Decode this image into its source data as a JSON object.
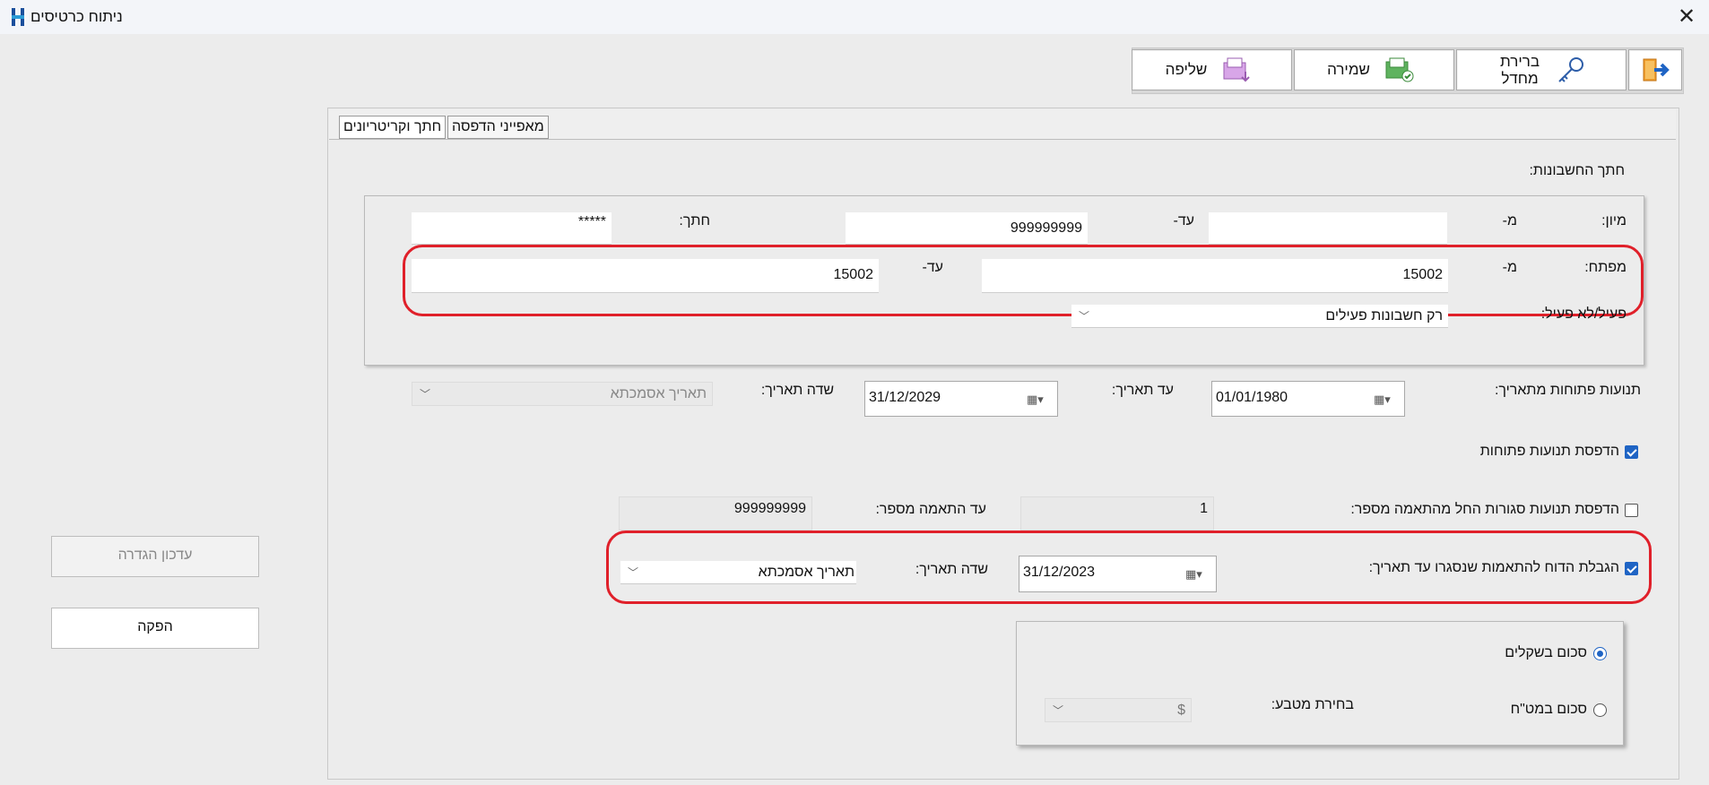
{
  "window": {
    "title": "ניתוח כרטיסים",
    "logo": "H"
  },
  "toolbar": {
    "exit_icon": "exit-door-arrow-icon",
    "password_label_line1": "ברירת",
    "password_label_line2": "מחדל",
    "save_label": "שמירה",
    "retrieve_label": "שליפה"
  },
  "tabs": {
    "criteria": "חתך וקריטריונים",
    "print": "מאפייני הדפסה"
  },
  "accounts_section": {
    "title": "חתך החשבונות:",
    "sort_label": "מיון:",
    "from_label": "מ-",
    "to_label": "עד-",
    "sort_from": "",
    "sort_to": "999999999",
    "cut_label": "חתך:",
    "cut_value": "*****",
    "key_label": "מפתח:",
    "key_from": "15002",
    "key_to": "15002",
    "active_label": "פעיל/לא פעיל:",
    "active_value": "רק חשבונות פעילים"
  },
  "dates": {
    "open_from_label": "תנועות פתוחות מתאריך:",
    "open_from_value": "01/01/1980",
    "to_date_label": "עד תאריך:",
    "to_date_value": "31/12/2029",
    "date_field_label": "שדה תאריך:",
    "date_field_value": "תאריך אסמכתא"
  },
  "print_open": {
    "label": "הדפסת תנועות פתוחות",
    "checked": true
  },
  "print_closed": {
    "label": "הדפסת תנועות סגורות החל מהתאמה מספר:",
    "checked": false,
    "from_value": "1",
    "to_label": "עד התאמה מספר:",
    "to_value": "999999999"
  },
  "limit_report": {
    "label": "הגבלת הדוח להתאמות שנסגרו עד תאריך:",
    "checked": true,
    "date_value": "31/12/2023",
    "date_field_label": "שדה תאריך:",
    "date_field_value": "תאריך אסמכתא"
  },
  "currency": {
    "shekel_label": "סכום בשקלים",
    "foreign_label": "סכום במט\"ח",
    "selected": "shekel",
    "currency_choice_label": "בחירת מטבע:",
    "currency_value": "$"
  },
  "side": {
    "update_label": "עדכון הגדרה",
    "produce_label": "הפקה"
  },
  "colors": {
    "highlight": "#e0202a",
    "accent": "#1f64c4"
  }
}
